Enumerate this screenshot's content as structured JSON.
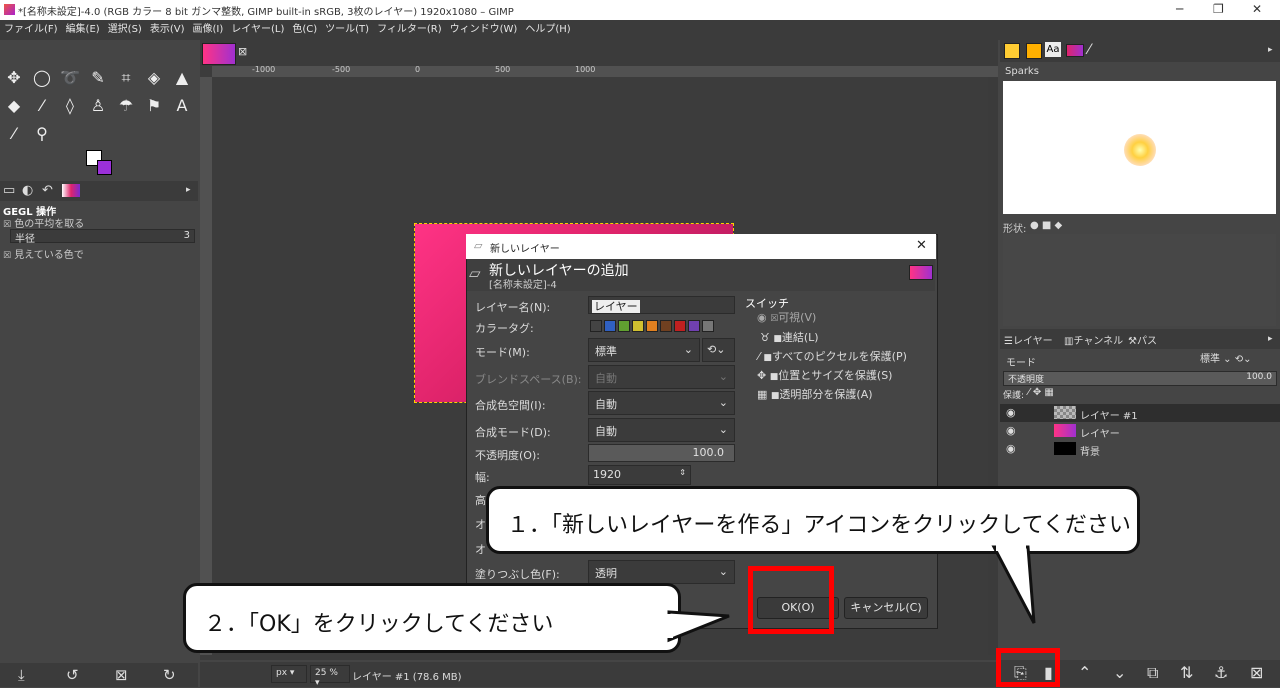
{
  "window": {
    "title": "*[名称未設定]-4.0 (RGB カラー 8 bit ガンマ整数, GIMP built-in sRGB, 3枚のレイヤー) 1920x1080 – GIMP",
    "minimize": "─",
    "maximize": "❐",
    "close": "✕"
  },
  "menu": [
    "ファイル(F)",
    "編集(E)",
    "選択(S)",
    "表示(V)",
    "画像(I)",
    "レイヤー(L)",
    "色(C)",
    "ツール(T)",
    "フィルター(R)",
    "ウィンドウ(W)",
    "ヘルプ(H)"
  ],
  "left_panel": {
    "gegl_title": "GEGL 操作",
    "option1": "色の平均を取る",
    "radius_label": "半径",
    "radius_value": "3",
    "option2": "見えている色で"
  },
  "rulers": {
    "h": [
      "-1000",
      "-500",
      "0",
      "500",
      "1000"
    ]
  },
  "dialog": {
    "title": "新しいレイヤー",
    "header": "新しいレイヤーの追加",
    "subheader": "[名称未設定]-4",
    "layer_name_label": "レイヤー名(N):",
    "layer_name_value": "レイヤー",
    "color_tag_label": "カラータグ:",
    "mode_label": "モード(M):",
    "mode_value": "標準",
    "blend_space_label": "ブレンドスペース(B):",
    "blend_space_value": "自動",
    "composite_space_label": "合成色空間(I):",
    "composite_space_value": "自動",
    "composite_mode_label": "合成モード(D):",
    "composite_mode_value": "自動",
    "opacity_label": "不透明度(O):",
    "opacity_value": "100.0",
    "width_label": "幅:",
    "width_value": "1920",
    "height_label": "高",
    "offx_label": "オ",
    "offy_label": "オ",
    "fill_label": "塗りつぶし色(F):",
    "fill_value": "透明",
    "switch_title": "スイッチ",
    "sw_visible": "可視(V)",
    "sw_link": "連結(L)",
    "sw_protect_pixels": "すべてのピクセルを保護(P)",
    "sw_protect_pos": "位置とサイズを保護(S)",
    "sw_protect_alpha": "透明部分を保護(A)",
    "ok": "OK(O)",
    "cancel": "キャンセル(C)"
  },
  "right_panel": {
    "brush_name": "Sparks",
    "shape_label": "形状:",
    "tabs": [
      "レイヤー",
      "チャンネル",
      "パス"
    ],
    "mode_label": "モード",
    "mode_value": "標準",
    "opacity_label": "不透明度",
    "opacity_value": "100.0",
    "protect_label": "保護:",
    "layers": [
      {
        "name": "レイヤー #1"
      },
      {
        "name": "レイヤー"
      },
      {
        "name": "背景"
      }
    ]
  },
  "statusbar": {
    "unit": "px",
    "zoom": "25 %",
    "info": "レイヤー #1 (78.6 MB)"
  },
  "callouts": {
    "one": "１．「新しいレイヤーを作る」アイコンをクリックしてください",
    "two": "２．「OK」をクリックしてください"
  },
  "colors": {
    "highlight": "#ff0000",
    "accent": "#ff3385"
  }
}
